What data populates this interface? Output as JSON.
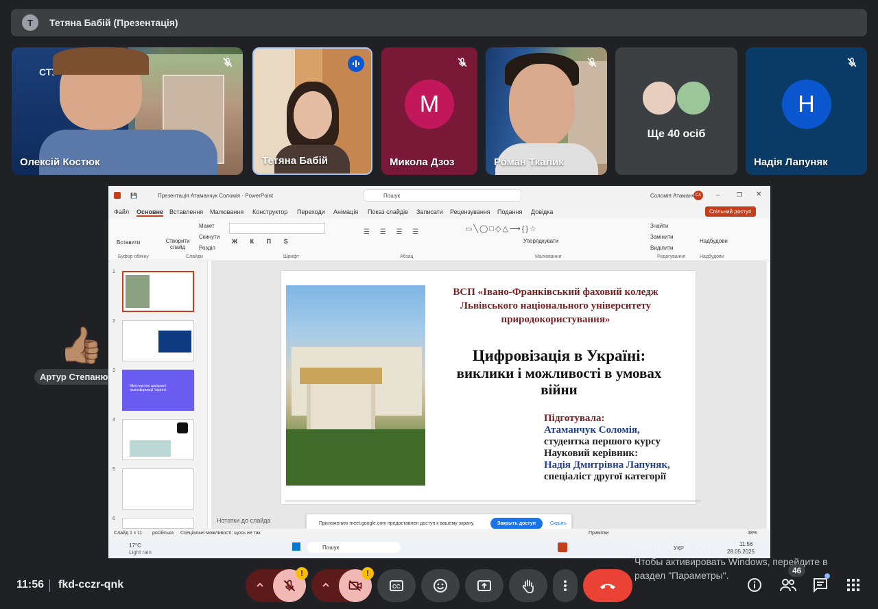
{
  "presenting": {
    "avatar_letter": "T",
    "title": "Тетяна Бабій (Презентація)"
  },
  "tiles": [
    {
      "name": "Олексій Костюк"
    },
    {
      "name": "Тетяна Бабій"
    },
    {
      "name": "Микола Дзоз",
      "avatar_letter": "M"
    },
    {
      "name": "Роман Ткалик"
    },
    {
      "name": "Ще 40 осіб"
    },
    {
      "name": "Надія Лапуняк",
      "avatar_letter": "H"
    }
  ],
  "reaction": {
    "emoji": "👍🏽",
    "name": "Артур Степанюк"
  },
  "ppt": {
    "window_title": "Презентація Атаманчук Соломія · PowerPoint",
    "search": "Пошук",
    "user": "Соломія Атаманчук",
    "user_initials": "СА",
    "menu": [
      "Файл",
      "Основне",
      "Вставлення",
      "Малювання",
      "Конструктор",
      "Переходи",
      "Анімація",
      "Показ слайдів",
      "Записати",
      "Рецензування",
      "Подання",
      "Довідка"
    ],
    "share": "Спільний доступ",
    "ribbon": {
      "paste": "Вставити",
      "new_slide": "Створити слайд",
      "layout": "Макет",
      "reset": "Скинути",
      "section": "Розділ",
      "arrange": "Упорядкувати",
      "find": "Знайти",
      "replace": "Замінити",
      "select": "Виділити",
      "addins": "Надбудови",
      "group_clipboard": "Буфер обміну",
      "group_slides": "Слайди",
      "group_font": "Шрифт",
      "group_paragraph": "Абзац",
      "group_drawing": "Малювання",
      "group_editing": "Редагування",
      "group_addins": "Надбудови"
    },
    "thumb_nums": [
      "1",
      "2",
      "3",
      "4",
      "5",
      "6"
    ],
    "thumb3_text": "Міністерство цифрової трансформації України",
    "slide": {
      "institution": "ВСП «Івано-Франківський фаховий коледж Львівського національного університету природокористування»",
      "title_line1": "Цифровізація в Україні:",
      "title_line2": "виклики і можливості в умовах",
      "title_line3": "війни",
      "l1": "Підготувала:",
      "l2": "Атаманчук Соломія,",
      "l3": "студентка першого курсу",
      "l4": "Науковий керівник:",
      "l5": "Надія Дмитрівна Лапуняк,",
      "l6": "спеціаліст другої категорії"
    },
    "notes": "Нотатки до слайда",
    "share_msg": "Приложению meet.google.com предоставлен доступ к вашему экрану.",
    "stop_share": "Закрыть доступ",
    "hide": "Скрыть",
    "status_slide": "Слайд 1 з 11",
    "status_lang": "російська",
    "status_access": "Спеціальні можливості: щось не так",
    "status_notes": "Нотатки",
    "status_comments": "Примітки",
    "zoom": "38%",
    "weather_temp": "17°C",
    "weather_desc": "Light rain",
    "taskbar_search": "Пошук",
    "tb_lang": "УКР",
    "tb_time": "11:56",
    "tb_date": "28.05.2025"
  },
  "activation": {
    "line1": "Активация Windows",
    "line2": "Чтобы активировать Windows, перейдите в",
    "line3": "раздел \"Параметры\"."
  },
  "meeting": {
    "time": "11:56",
    "code": "fkd-cczr-qnk"
  },
  "participants_count": "46"
}
